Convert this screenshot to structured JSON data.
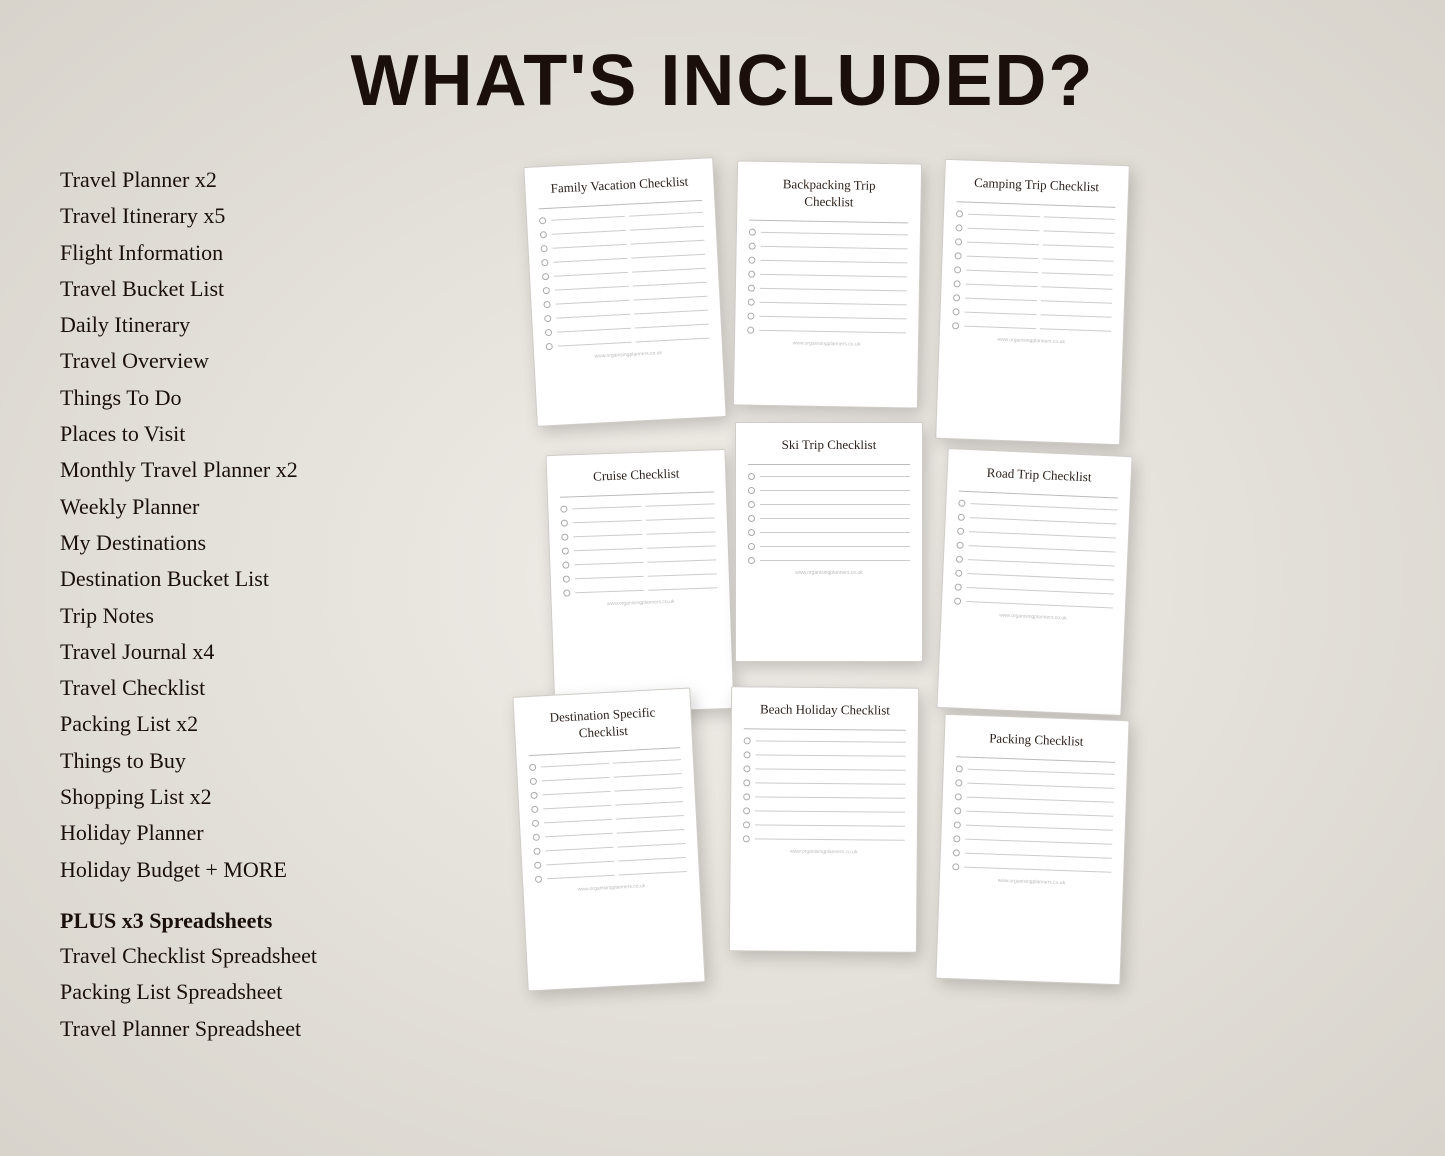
{
  "header": {
    "title": "WHAT'S INCLUDED?"
  },
  "list": {
    "items": [
      "Travel Planner x2",
      "Travel Itinerary x5",
      "Flight Information",
      "Travel Bucket List",
      "Daily Itinerary",
      "Travel Overview",
      "Things To Do",
      "Places to Visit",
      "Monthly Travel Planner x2",
      "Weekly Planner",
      "My Destinations",
      "Destination Bucket List",
      "Trip Notes",
      "Travel Journal x4",
      "Travel Checklist",
      "Packing List x2",
      "Things to Buy",
      "Shopping List x2",
      "Holiday Planner",
      "Holiday Budget + MORE"
    ],
    "plus_title": "PLUS x3 Spreadsheets",
    "plus_items": [
      "Travel Checklist Spreadsheet",
      "Packing List Spreadsheet",
      "Travel Planner Spreadsheet"
    ]
  },
  "cards": [
    {
      "id": "family-vacation",
      "title": "Family Vacation Checklist",
      "footer": "www.organisingplanners.co.uk"
    },
    {
      "id": "backpacking-trip",
      "title": "Backpacking Trip\nChecklist",
      "footer": "www.organisingplanners.co.uk"
    },
    {
      "id": "camping-trip",
      "title": "Camping Trip Checklist",
      "footer": "www.organisingplanners.co.uk"
    },
    {
      "id": "cruise",
      "title": "Cruise Checklist",
      "footer": "www.organisingplanners.co.uk"
    },
    {
      "id": "ski-trip",
      "title": "Ski Trip Checklist",
      "footer": "www.organisingplanners.co.uk"
    },
    {
      "id": "road-trip",
      "title": "Road Trip Checklist",
      "footer": "www.organisingplanners.co.uk"
    },
    {
      "id": "destination-specific",
      "title": "Destination Specific\nChecklist",
      "footer": "www.organisingplanners.co.uk"
    },
    {
      "id": "beach-holiday",
      "title": "Beach Holiday Checklist",
      "footer": "www.organisingplanners.co.uk"
    },
    {
      "id": "packing",
      "title": "Packing Checklist",
      "footer": "www.organisingplanners.co.uk"
    }
  ]
}
